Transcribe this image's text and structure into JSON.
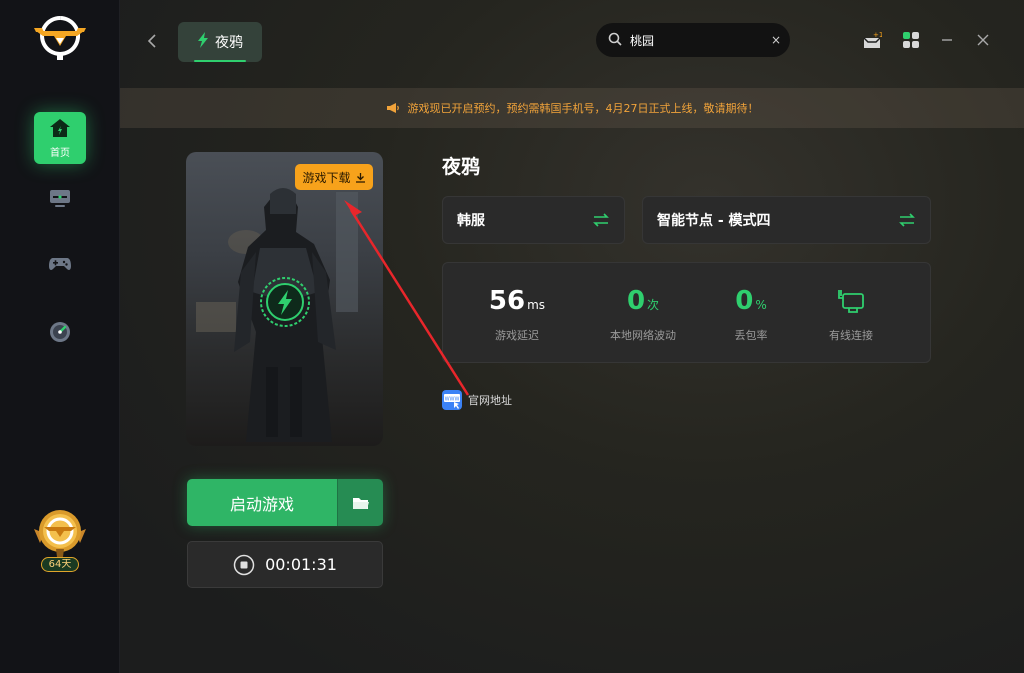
{
  "sidebar": {
    "items": [
      {
        "label": "首页",
        "icon": "home-icon",
        "active": true
      },
      {
        "label": "",
        "icon": "monitor-icon"
      },
      {
        "label": "",
        "icon": "gamepad-icon"
      },
      {
        "label": "",
        "icon": "speedometer-icon"
      }
    ],
    "membership": {
      "days": "64天"
    }
  },
  "header": {
    "tab_label": "夜鸦",
    "search_value": "桃园",
    "clear": "×"
  },
  "banner": {
    "text": "游戏现已开启预约，预约需韩国手机号，4月27日正式上线，敬请期待！"
  },
  "cover": {
    "download_label": "游戏下载"
  },
  "actions": {
    "launch_label": "启动游戏",
    "timer": "00:01:31"
  },
  "game": {
    "title": "夜鸦",
    "server": "韩服",
    "node": "智能节点 - 模式四"
  },
  "stats": [
    {
      "value": "56",
      "unit": "ms",
      "label": "游戏延迟",
      "color": "#ffffff"
    },
    {
      "value": "0",
      "unit": "次",
      "label": "本地网络波动",
      "color": "#2fcf6e"
    },
    {
      "value": "0",
      "unit": "%",
      "label": "丢包率",
      "color": "#2fcf6e"
    },
    {
      "value": "",
      "unit": "",
      "label": "有线连接",
      "color": "#2fcf6e"
    }
  ],
  "website": {
    "label": "官网地址",
    "icon_text": "WWW"
  },
  "colors": {
    "accent": "#2fcf6e",
    "warning": "#f7a21b",
    "banner_text": "#f1a33a"
  }
}
